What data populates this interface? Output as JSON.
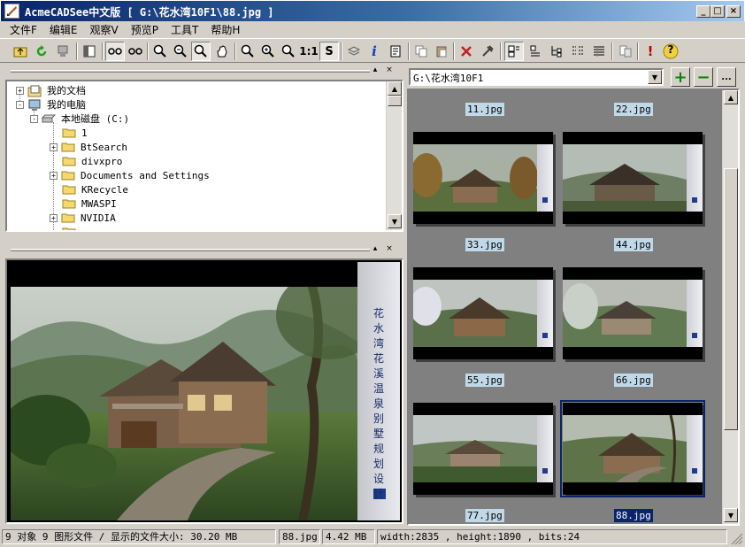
{
  "window": {
    "title": "AcmeCADSee中文版 [ G:\\花水湾10F1\\88.jpg ]",
    "minimize": "_",
    "maximize": "□",
    "close": "×"
  },
  "menu": [
    {
      "label": "文件F"
    },
    {
      "label": "编辑E"
    },
    {
      "label": "观察V"
    },
    {
      "label": "预览P"
    },
    {
      "label": "工具T"
    },
    {
      "label": "帮助H"
    }
  ],
  "toolbar": {
    "zoom_actual_label": "1:1",
    "s_label": "S",
    "info_label": "i",
    "alert_label": "!",
    "help_label": "?"
  },
  "tree": {
    "items": [
      {
        "label": "我的文档",
        "expander": "+",
        "icon": "documents-icon"
      },
      {
        "label": "我的电脑",
        "expander": "-",
        "icon": "computer-icon"
      },
      {
        "label": "本地磁盘 (C:)",
        "expander": "-",
        "icon": "drive-icon"
      },
      {
        "label": "1",
        "expander": "",
        "icon": "folder-icon"
      },
      {
        "label": "BtSearch",
        "expander": "+",
        "icon": "folder-icon"
      },
      {
        "label": "divxpro",
        "expander": "",
        "icon": "folder-icon"
      },
      {
        "label": "Documents and Settings",
        "expander": "+",
        "icon": "folder-icon"
      },
      {
        "label": "KRecycle",
        "expander": "",
        "icon": "folder-icon"
      },
      {
        "label": "MWASPI",
        "expander": "",
        "icon": "folder-icon"
      },
      {
        "label": "NVIDIA",
        "expander": "+",
        "icon": "folder-icon"
      }
    ]
  },
  "preview": {
    "side_text": "花水湾花溪温泉别墅规划设计"
  },
  "browser": {
    "path": "G:\\花水湾10F1",
    "dropdown_arrow": "▼",
    "add_label": "+",
    "remove_label": "−",
    "more_label": "..."
  },
  "thumbnails": [
    {
      "label": "11.jpg",
      "selected": false
    },
    {
      "label": "22.jpg",
      "selected": false
    },
    {
      "label": "33.jpg",
      "selected": false
    },
    {
      "label": "44.jpg",
      "selected": false
    },
    {
      "label": "55.jpg",
      "selected": false
    },
    {
      "label": "66.jpg",
      "selected": false
    },
    {
      "label": "77.jpg",
      "selected": false
    },
    {
      "label": "88.jpg",
      "selected": true
    }
  ],
  "status": {
    "objects": "9 对象 9 图形文件 / 显示的文件大小: 30.20 MB",
    "filename": "88.jpg",
    "filesize": "4.42 MB",
    "dimensions": "width:2835 , height:1890 , bits:24"
  },
  "colors": {
    "title_gradient_start": "#0a246a",
    "title_gradient_end": "#a6caf0",
    "selection": "#0a246a",
    "thumb_label_bg": "#c0d8e8",
    "browser_bg": "#808080"
  }
}
